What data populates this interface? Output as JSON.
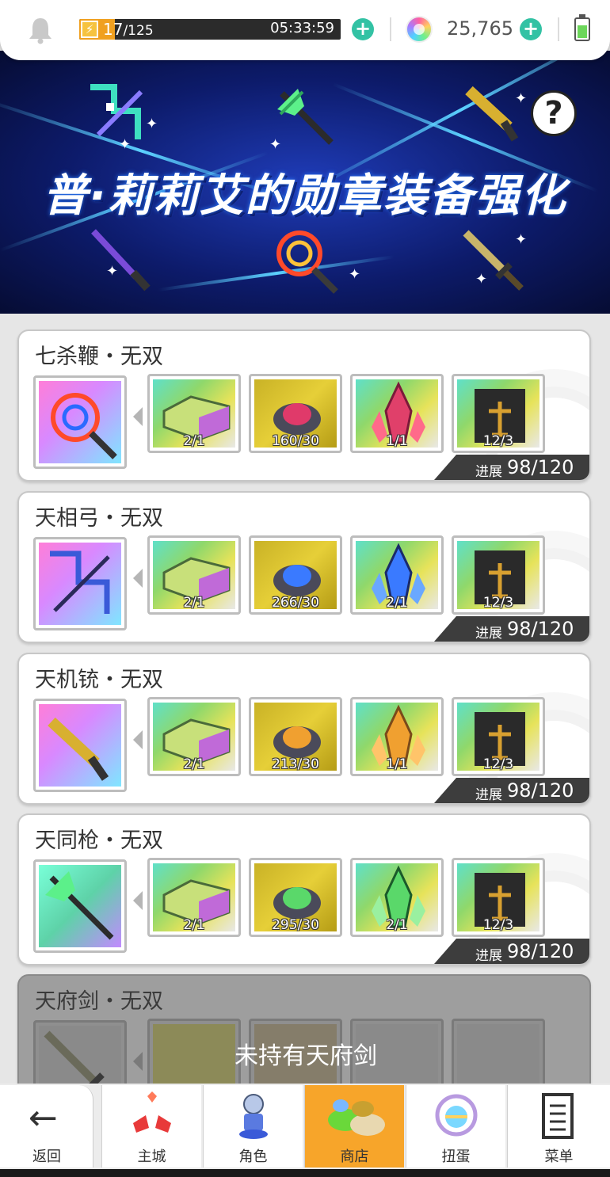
{
  "status_bar": {
    "stamina_current": "17",
    "stamina_max": "/125",
    "stamina_fraction": 0.136,
    "timer": "05:33:59",
    "gems": "25,765",
    "plus_symbol": "+"
  },
  "banner": {
    "title": "普·莉莉艾的勋章装备强化",
    "help_symbol": "?"
  },
  "cards": [
    {
      "name": "七杀鞭・无双",
      "materials": [
        "2/1",
        "160/30",
        "1/1",
        "12/3"
      ],
      "progress_label": "进展",
      "progress_value": "98/120"
    },
    {
      "name": "天相弓・无双",
      "materials": [
        "2/1",
        "266/30",
        "2/1",
        "12/3"
      ],
      "progress_label": "进展",
      "progress_value": "98/120"
    },
    {
      "name": "天机铳・无双",
      "materials": [
        "2/1",
        "213/30",
        "1/1",
        "12/3"
      ],
      "progress_label": "进展",
      "progress_value": "98/120"
    },
    {
      "name": "天同枪・无双",
      "materials": [
        "2/1",
        "295/30",
        "2/1",
        "12/3"
      ],
      "progress_label": "进展",
      "progress_value": "98/120"
    },
    {
      "name": "天府剑・无双",
      "locked_message": "未持有天府剑"
    }
  ],
  "bottom_nav": {
    "back": "返回",
    "items": [
      "主城",
      "角色",
      "商店",
      "扭蛋",
      "菜单"
    ],
    "active": "商店"
  },
  "colors": {
    "accent_teal": "#33c2a4",
    "nav_active": "#f7a52a",
    "banner_blue": "#1f3cb8"
  }
}
